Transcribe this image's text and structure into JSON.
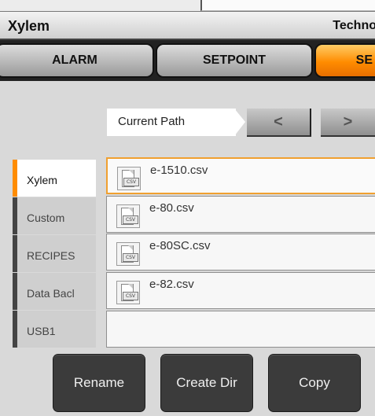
{
  "header": {
    "title": "Xylem",
    "right_text": "Techno"
  },
  "tabs": [
    {
      "label": "ALARM",
      "active": false
    },
    {
      "label": "SETPOINT",
      "active": false
    },
    {
      "label": "SE",
      "active": true
    }
  ],
  "path": {
    "label": "Current Path",
    "back_icon": "chevron-left-icon",
    "forward_icon": "chevron-right-icon",
    "back_glyph": "<",
    "forward_glyph": ">"
  },
  "sidebar": {
    "items": [
      {
        "label": "Xylem",
        "active": true
      },
      {
        "label": "Custom",
        "active": false
      },
      {
        "label": "RECIPES",
        "active": false
      },
      {
        "label": "Data Bacl",
        "active": false
      },
      {
        "label": "USB1",
        "active": false
      }
    ]
  },
  "files": [
    {
      "name": "e-1510.csv",
      "icon_text": "CSV",
      "selected": true
    },
    {
      "name": "e-80.csv",
      "icon_text": "CSV",
      "selected": false
    },
    {
      "name": "e-80SC.csv",
      "icon_text": "CSV",
      "selected": false
    },
    {
      "name": "e-82.csv",
      "icon_text": "CSV",
      "selected": false
    },
    {
      "name": "",
      "icon_text": "",
      "selected": false
    }
  ],
  "buttons": {
    "rename": "Rename",
    "create_dir": "Create Dir",
    "copy": "Copy"
  },
  "colors": {
    "accent": "#ff8c00",
    "selected_border": "#f0a030",
    "button_bg": "#3b3b3b"
  }
}
